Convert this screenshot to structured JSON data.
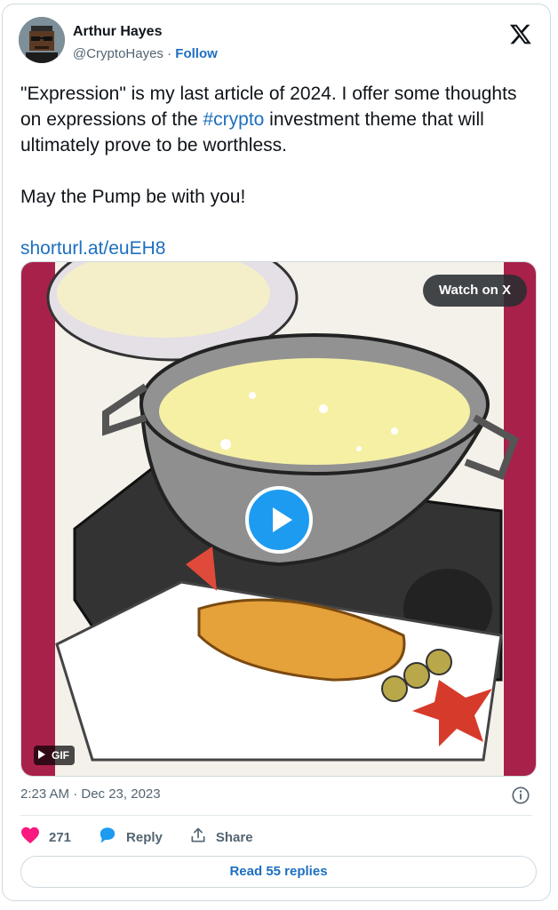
{
  "author": {
    "name": "Arthur Hayes",
    "handle": "@CryptoHayes",
    "separator": "·",
    "follow_label": "Follow"
  },
  "tweet": {
    "text_part1": "\"Expression\" is my last article of 2024. I offer some thoughts on expressions of the ",
    "hashtag": "#crypto",
    "text_part2": " investment theme that will ultimately prove to be worthless.",
    "line2": "May the Pump be with you!",
    "link": "shorturl.at/euEH8"
  },
  "media": {
    "watch_label": "Watch on X",
    "gif_label": "GIF"
  },
  "meta": {
    "timestamp": "2:23 AM · Dec 23, 2023"
  },
  "actions": {
    "like_count": "271",
    "reply_label": "Reply",
    "share_label": "Share"
  },
  "footer": {
    "read_replies_label": "Read 55 replies"
  },
  "colors": {
    "accent": "#1d6fbf",
    "like": "#f91880",
    "play": "#1d9bf0",
    "frame": "#a8214a"
  },
  "icons": [
    "avatar",
    "x-logo-icon",
    "play-icon",
    "gif-play-icon",
    "info-icon",
    "heart-icon",
    "reply-icon",
    "share-icon"
  ]
}
